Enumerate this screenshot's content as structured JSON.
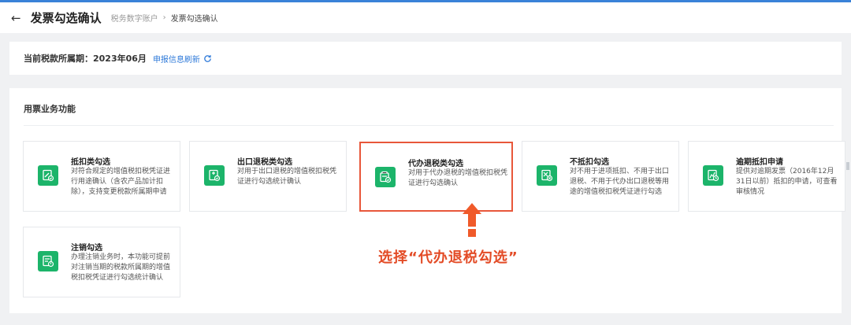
{
  "header": {
    "back_icon": "←",
    "title": "发票勾选确认",
    "breadcrumb": [
      "税务数字账户",
      "发票勾选确认"
    ],
    "breadcrumb_sep": "›"
  },
  "period": {
    "label": "当前税款所属期：2023年06月",
    "refresh": "申报信息刷新"
  },
  "section": {
    "title": "用票业务功能"
  },
  "cards": [
    {
      "title": "抵扣类勾选",
      "desc": "对符合规定的增值税扣税凭证进行用途确认（含农产品加计扣除），支持变更税款所属期申请",
      "icon": "invoice-check-icon"
    },
    {
      "title": "出口退税类勾选",
      "desc": "对用于出口退税的增值税扣税凭证进行勾选统计确认",
      "icon": "export-refund-icon"
    },
    {
      "title": "代办退税类勾选",
      "desc": "对用于代办退税的增值税扣税凭证进行勾选确认",
      "icon": "agent-refund-icon"
    },
    {
      "title": "不抵扣勾选",
      "desc": "对不用于进项抵扣、不用于出口退税、不用于代办出口退税等用途的增值税扣税凭证进行勾选",
      "icon": "no-deduct-icon"
    },
    {
      "title": "逾期抵扣申请",
      "desc": "提供对逾期发票（2016年12月31日以前）抵扣的申请，可查看审核情况",
      "icon": "overdue-deduct-icon"
    },
    {
      "title": "注销勾选",
      "desc": "办理注销业务时，本功能可提前对注销当期的税款所属期的增值税扣税凭证进行勾选统计确认",
      "icon": "cancel-check-icon"
    }
  ],
  "annotation": {
    "callout": "选择“代办退税勾选”"
  },
  "colors": {
    "accent": "#2f7ad9",
    "icon_bg": "#1cb46a",
    "highlight": "#e8573a"
  }
}
